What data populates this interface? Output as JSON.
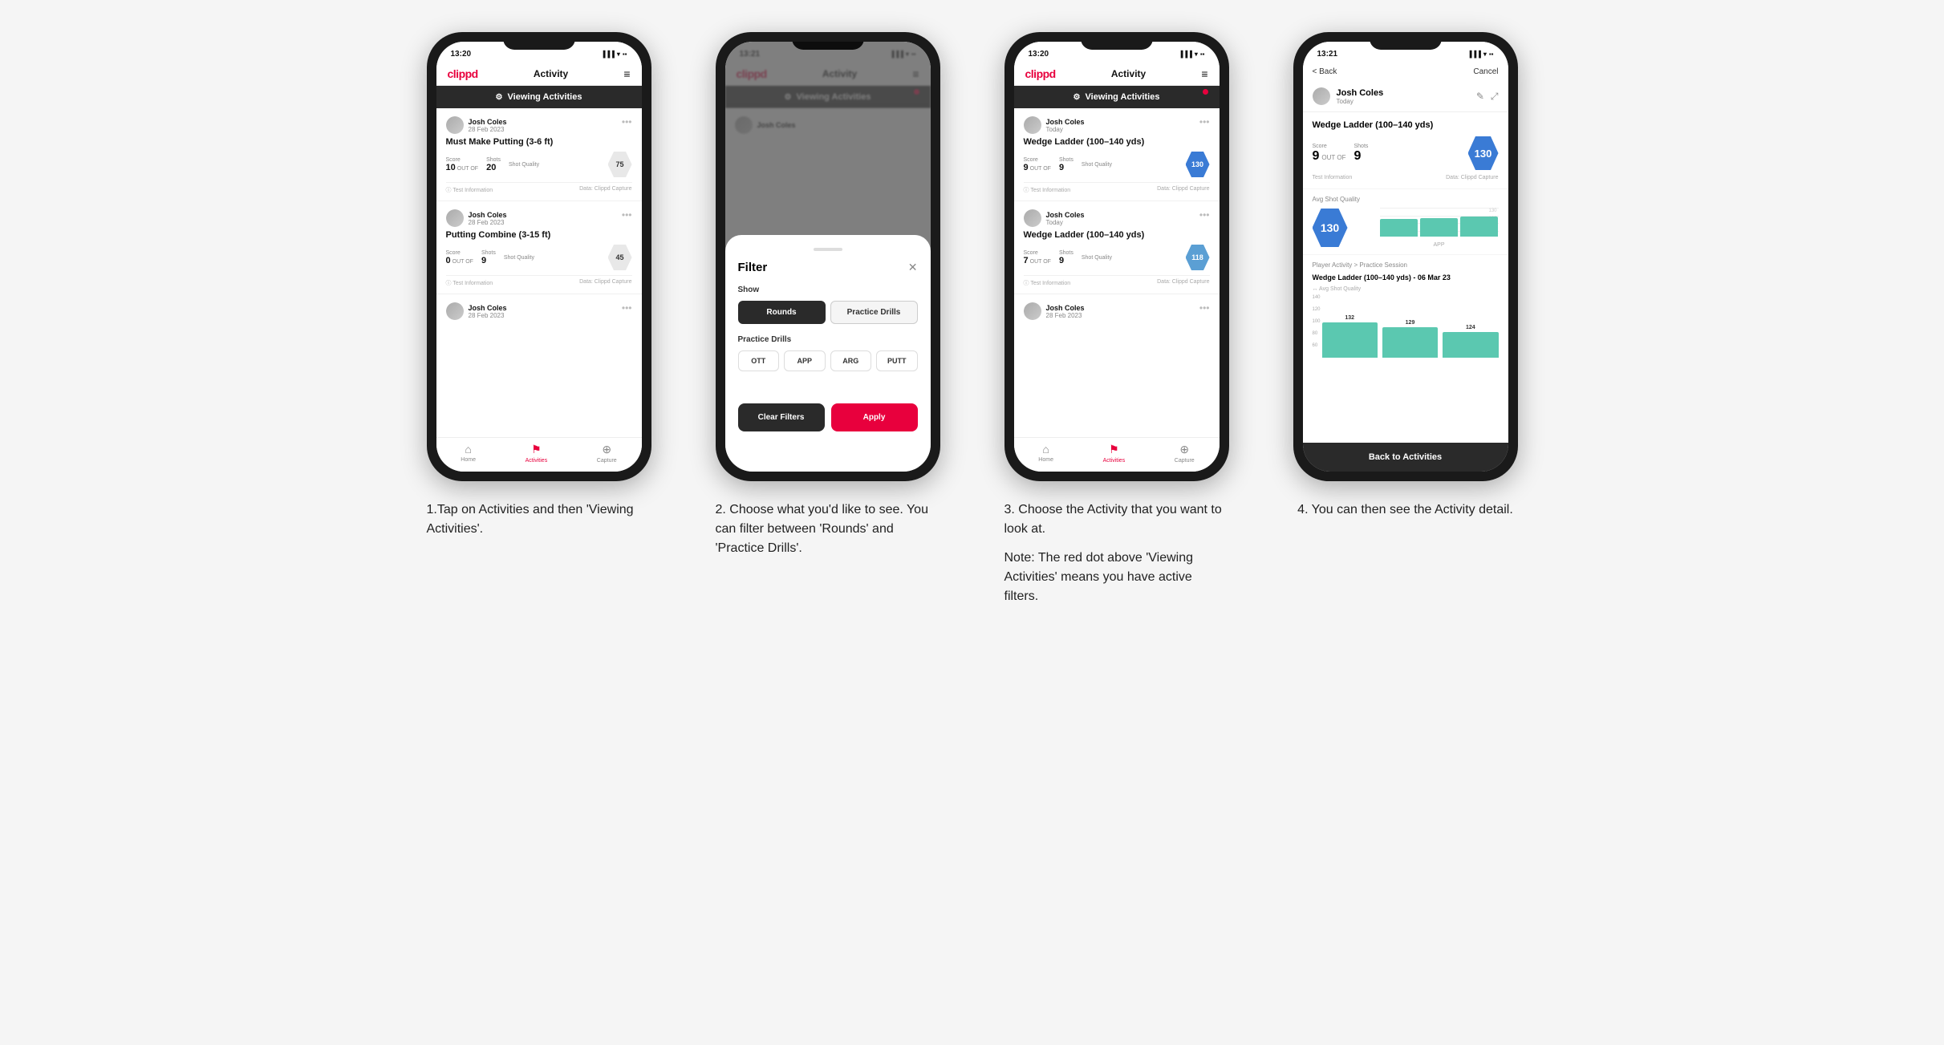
{
  "app": {
    "logo": "clippd",
    "nav_title": "Activity",
    "menu_icon": "≡"
  },
  "steps": [
    {
      "id": 1,
      "caption": "1.Tap on Activities and then 'Viewing Activities'.",
      "phone": {
        "status_time": "13:20",
        "viewing_activities": "Viewing Activities",
        "show_red_dot": false,
        "cards": [
          {
            "user_name": "Josh Coles",
            "user_date": "28 Feb 2023",
            "title": "Must Make Putting (3-6 ft)",
            "score_label": "Score",
            "shots_label": "Shots",
            "sq_label": "Shot Quality",
            "score": "10",
            "out_of": "OUT OF",
            "shots": "20",
            "sq_value": "75",
            "sq_style": "normal"
          },
          {
            "user_name": "Josh Coles",
            "user_date": "28 Feb 2023",
            "title": "Putting Combine (3-15 ft)",
            "score_label": "Score",
            "shots_label": "Shots",
            "sq_label": "Shot Quality",
            "score": "0",
            "out_of": "OUT OF",
            "shots": "9",
            "sq_value": "45",
            "sq_style": "normal"
          },
          {
            "user_name": "Josh Coles",
            "user_date": "28 Feb 2023",
            "title": "",
            "score": "",
            "shots": "",
            "sq_value": ""
          }
        ]
      }
    },
    {
      "id": 2,
      "caption_lines": [
        "2. Choose what you'd",
        "like to see. You can",
        "filter between 'Rounds'",
        "and 'Practice Drills'."
      ],
      "caption": "2. Choose what you'd like to see. You can filter between 'Rounds' and 'Practice Drills'.",
      "phone": {
        "status_time": "13:21",
        "viewing_activities": "Viewing Activities",
        "filter_modal": {
          "title": "Filter",
          "show_label": "Show",
          "rounds_label": "Rounds",
          "practice_drills_label": "Practice Drills",
          "practice_drills_section": "Practice Drills",
          "drill_options": [
            "OTT",
            "APP",
            "ARG",
            "PUTT"
          ],
          "clear_filters": "Clear Filters",
          "apply": "Apply"
        }
      }
    },
    {
      "id": 3,
      "caption": "3. Choose the Activity that you want to look at.",
      "caption_note": "Note: The red dot above 'Viewing Activities' means you have active filters.",
      "phone": {
        "status_time": "13:20",
        "viewing_activities": "Viewing Activities",
        "show_red_dot": true,
        "cards": [
          {
            "user_name": "Josh Coles",
            "user_date": "Today",
            "title": "Wedge Ladder (100–140 yds)",
            "score_label": "Score",
            "shots_label": "Shots",
            "sq_label": "Shot Quality",
            "score": "9",
            "out_of": "OUT OF",
            "shots": "9",
            "sq_value": "130",
            "sq_style": "blue"
          },
          {
            "user_name": "Josh Coles",
            "user_date": "Today",
            "title": "Wedge Ladder (100–140 yds)",
            "score_label": "Score",
            "shots_label": "Shots",
            "sq_label": "Shot Quality",
            "score": "7",
            "out_of": "OUT OF",
            "shots": "9",
            "sq_value": "118",
            "sq_style": "blue-light"
          },
          {
            "user_name": "Josh Coles",
            "user_date": "28 Feb 2023",
            "title": "",
            "score": "",
            "shots": "",
            "sq_value": ""
          }
        ]
      }
    },
    {
      "id": 4,
      "caption": "4. You can then see the Activity detail.",
      "phone": {
        "status_time": "13:21",
        "detail": {
          "back_label": "< Back",
          "cancel_label": "Cancel",
          "user_name": "Josh Coles",
          "user_sub": "Today",
          "activity_title": "Wedge Ladder (100–140 yds)",
          "score_label": "Score",
          "shots_label": "Shots",
          "score_title": "Wedge Ladder\n(100–140 yds)",
          "score": "9",
          "out_of": "OUT OF",
          "shots": "9",
          "sq_value": "130",
          "test_info": "Test Information",
          "data_source": "Data: Clippd Capture",
          "avg_sq_label": "Avg Shot Quality",
          "avg_sq_value": "130",
          "chart_label": "APP",
          "practice_session_breadcrumb": "Player Activity > Practice Session",
          "practice_session_title": "Wedge Ladder (100–140 yds) - 06 Mar 23",
          "ps_sub": "↔ Avg Shot Quality",
          "bars": [
            {
              "value": 132,
              "label": ""
            },
            {
              "value": 129,
              "label": ""
            },
            {
              "value": 124,
              "label": ""
            }
          ],
          "y_labels": [
            "140",
            "120",
            "100",
            "80",
            "60"
          ],
          "back_to_activities": "Back to Activities"
        }
      }
    }
  ]
}
